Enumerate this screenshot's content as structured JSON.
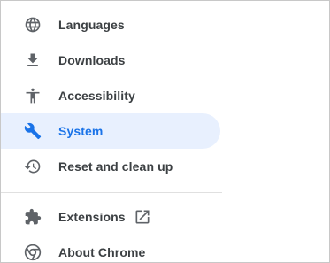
{
  "nav": {
    "items": [
      {
        "label": "Languages",
        "icon": "globe-icon"
      },
      {
        "label": "Downloads",
        "icon": "download-icon"
      },
      {
        "label": "Accessibility",
        "icon": "accessibility-icon"
      },
      {
        "label": "System",
        "icon": "wrench-icon",
        "active": true
      },
      {
        "label": "Reset and clean up",
        "icon": "restore-icon"
      }
    ],
    "bottom_items": [
      {
        "label": "Extensions",
        "icon": "extension-puzzle-icon",
        "trailing_icon": "open-in-new-icon"
      },
      {
        "label": "About Chrome",
        "icon": "chrome-logo-icon"
      }
    ]
  },
  "colors": {
    "active_bg": "#e8f0fe",
    "active_text": "#1a73e8",
    "text": "#3c4043",
    "icon": "#5f6368"
  }
}
